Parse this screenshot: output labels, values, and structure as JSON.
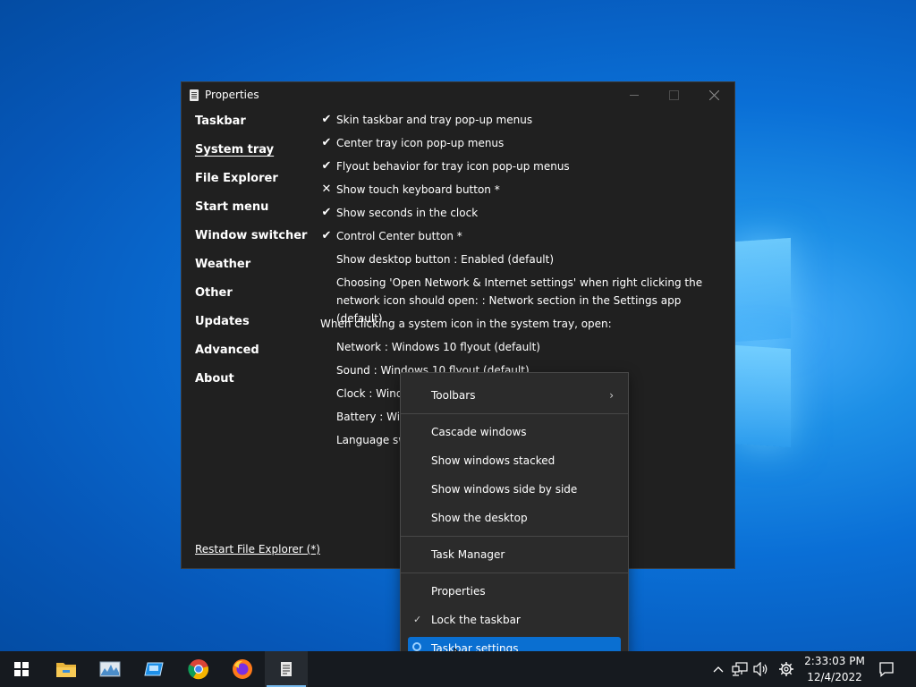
{
  "window": {
    "title": "Properties"
  },
  "sidebar": {
    "items": [
      {
        "label": "Taskbar"
      },
      {
        "label": "System tray"
      },
      {
        "label": "File Explorer"
      },
      {
        "label": "Start menu"
      },
      {
        "label": "Window switcher"
      },
      {
        "label": "Weather"
      },
      {
        "label": "Other"
      },
      {
        "label": "Updates"
      },
      {
        "label": "Advanced"
      },
      {
        "label": "About"
      }
    ],
    "active": "System tray",
    "restart_label": "Restart File Explorer (*)"
  },
  "options": [
    {
      "mark": "✔",
      "label": "Skin taskbar and tray pop-up menus"
    },
    {
      "mark": "✔",
      "label": "Center tray icon pop-up menus"
    },
    {
      "mark": "✔",
      "label": "Flyout behavior for tray icon pop-up menus"
    },
    {
      "mark": "✕",
      "label": "Show touch keyboard button *"
    },
    {
      "mark": "✔",
      "label": "Show seconds in the clock"
    },
    {
      "mark": "✔",
      "label": "Control Center button *"
    },
    {
      "mark": "",
      "label": "Show desktop button : Enabled (default)"
    },
    {
      "mark": "",
      "label": "Choosing 'Open Network & Internet settings' when right clicking the network icon should open: : Network section in the Settings app (default)"
    }
  ],
  "tray_section": {
    "heading": "When clicking a system icon in the system tray, open:",
    "items": [
      {
        "label": "Network : Windows 10 flyout (default)"
      },
      {
        "label": "Sound : Windows 10 flyout (default)"
      },
      {
        "label": "Clock : Windo"
      },
      {
        "label": "Battery : Wind"
      },
      {
        "label": "Language swi"
      }
    ]
  },
  "context_menu": {
    "toolbars": "Toolbars",
    "cascade": "Cascade windows",
    "stacked": "Show windows stacked",
    "side_by_side": "Show windows side by side",
    "desktop": "Show the desktop",
    "task_manager": "Task Manager",
    "properties": "Properties",
    "lock": "Lock the taskbar",
    "lock_checked": true,
    "settings": "Taskbar settings"
  },
  "taskbar": {
    "apps": [
      "start",
      "file-explorer",
      "resource-monitor",
      "remote-desktop",
      "chrome",
      "firefox",
      "properties"
    ],
    "time": "2:33:03 PM",
    "date": "12/4/2022"
  },
  "colors": {
    "window_bg": "#202020",
    "menu_bg": "#2b2b2b",
    "highlight": "#0a6fd1",
    "taskbar_bg": "#161a1f"
  }
}
